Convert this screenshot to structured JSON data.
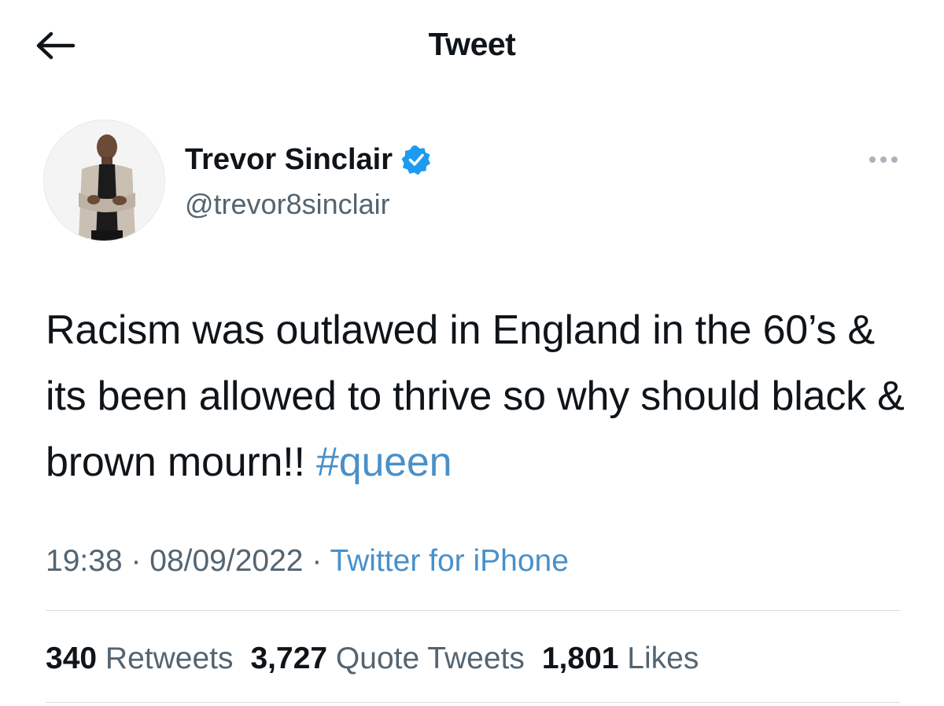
{
  "header": {
    "title": "Tweet",
    "back_icon": "arrow-left-icon"
  },
  "author": {
    "name": "Trevor Sinclair",
    "handle": "@trevor8sinclair",
    "verified": true,
    "verified_color": "#1d9bf0",
    "more_icon": "more-horizontal-icon"
  },
  "tweet": {
    "text": "Racism was outlawed in England in the 60’s & its been allowed to thrive so why should black & brown mourn!! ",
    "hashtag": "#queen",
    "time": "19:38",
    "separator": " · ",
    "date": "08/09/2022",
    "source": "Twitter for iPhone"
  },
  "stats": {
    "retweets_count": "340",
    "retweets_label": " Retweets",
    "quotes_count": "3,727",
    "quotes_label": " Quote Tweets",
    "likes_count": "1,801",
    "likes_label": " Likes"
  },
  "colors": {
    "link": "#4a90c8",
    "secondary_text": "#536471",
    "primary_text": "#0f1419"
  }
}
